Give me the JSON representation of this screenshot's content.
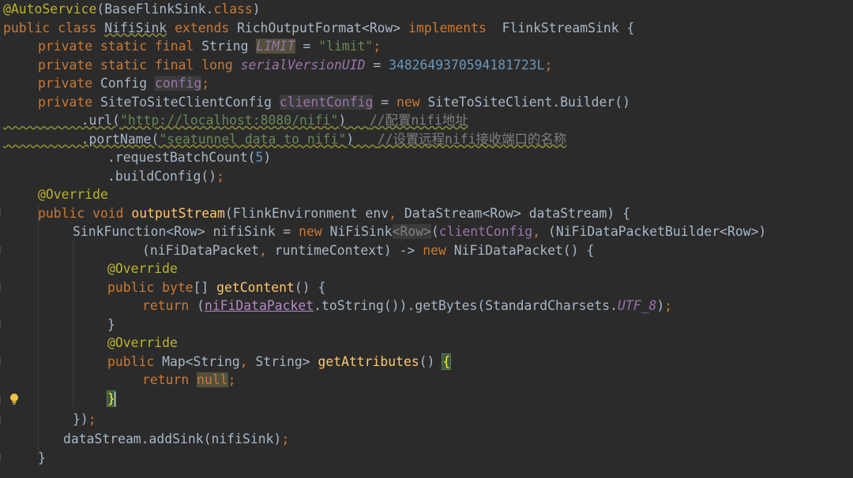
{
  "code": {
    "l1": {
      "a": "@AutoService",
      "b": "(BaseFlinkSink.",
      "c": "class",
      ")": ")"
    },
    "l2": {
      "a": "public class ",
      "b": "NifiSink",
      "c": " extends ",
      "d": "RichOutputFormat<Row> ",
      "e": "implements",
      "f": "  FlinkStreamSink {"
    },
    "l3": {
      "a": "private static final ",
      "b": "String ",
      "c": "LIMIT",
      "d": " = ",
      "e": "\"limit\"",
      "f": ";"
    },
    "l4": {
      "a": "private static final long ",
      "b": "serialVersionUID",
      "c": " = ",
      "d": "3482649370594181723L",
      "e": ";"
    },
    "l5": {
      "a": "private ",
      "b": "Config ",
      "c": "config",
      "d": ";"
    },
    "l6": {
      "a": "private ",
      "b": "SiteToSiteClientConfig ",
      "c": "clientConfig",
      "d": " = ",
      "e": "new ",
      "f": "SiteToSiteClient.Builder()"
    },
    "l7": {
      "a": ".url(",
      "b": "\"http://localhost:8080/nifi\"",
      "c": ")   ",
      "d": "//配置nifi地址"
    },
    "l8": {
      "a": ".portName(",
      "b": "\"seatunnel data to nifi\"",
      "c": ")   ",
      "d": "//设置远程nifi接收端口的名称"
    },
    "l9": {
      "a": ".requestBatchCount(",
      "b": "5",
      "c": ")"
    },
    "l10": {
      "a": ".buildConfig()",
      "b": ";"
    },
    "l11": {
      "a": "@Override"
    },
    "l12": {
      "a": "public void ",
      "b": "outputStream",
      "c": "(FlinkEnvironment env",
      "d": ", ",
      "e": "DataStream<Row> dataStream) {"
    },
    "l13": {
      "a": "SinkFunction<Row> nifiSink = ",
      "b": "new ",
      "c": "NiFiSink",
      "d": "<Row>",
      "e": "(",
      "f": "clientConfig",
      "g": ", ",
      "h": "(NiFiDataPacketBuilder<Row>)"
    },
    "l14": {
      "a": "(niFiDataPacket",
      "b": ", ",
      "c": "runtimeContext) -> ",
      "d": "new ",
      "e": "NiFiDataPacket() {"
    },
    "l15": {
      "a": "@Override"
    },
    "l16": {
      "a": "public ",
      "b": "byte",
      "c": "[] ",
      "d": "getContent",
      "e": "() {"
    },
    "l17": {
      "a": "return ",
      "b": "(",
      "c": "niFiDataPacket",
      "d": ".toString()).getBytes(StandardCharsets.",
      "e": "UTF_8",
      ")": ")",
      "f": ";"
    },
    "l18": {
      "a": "}"
    },
    "l19": {
      "a": "@Override"
    },
    "l20": {
      "a": "public ",
      "b": "Map<String",
      "c": ", ",
      "d": "String> ",
      "e": "getAttributes",
      "f": "() ",
      "g": "{"
    },
    "l21": {
      "a": "return ",
      "b": "null",
      "c": ";"
    },
    "l22": {
      "a": "}"
    },
    "l23": {
      "a": "})",
      "b": ";"
    },
    "l24": {
      "a": "dataStream.addSink(nifiSink)",
      "b": ";"
    },
    "l25": {
      "a": "}"
    }
  },
  "colors": {
    "background": "#2b2b2b",
    "keyword": "#cc7832",
    "string": "#6a8759",
    "number": "#6897bb",
    "function": "#ffc66d",
    "annotation": "#bbb529",
    "comment": "#808080",
    "field": "#9876aa",
    "text": "#a9b7c6"
  },
  "icons": {
    "gutter": "lightbulb-icon"
  }
}
